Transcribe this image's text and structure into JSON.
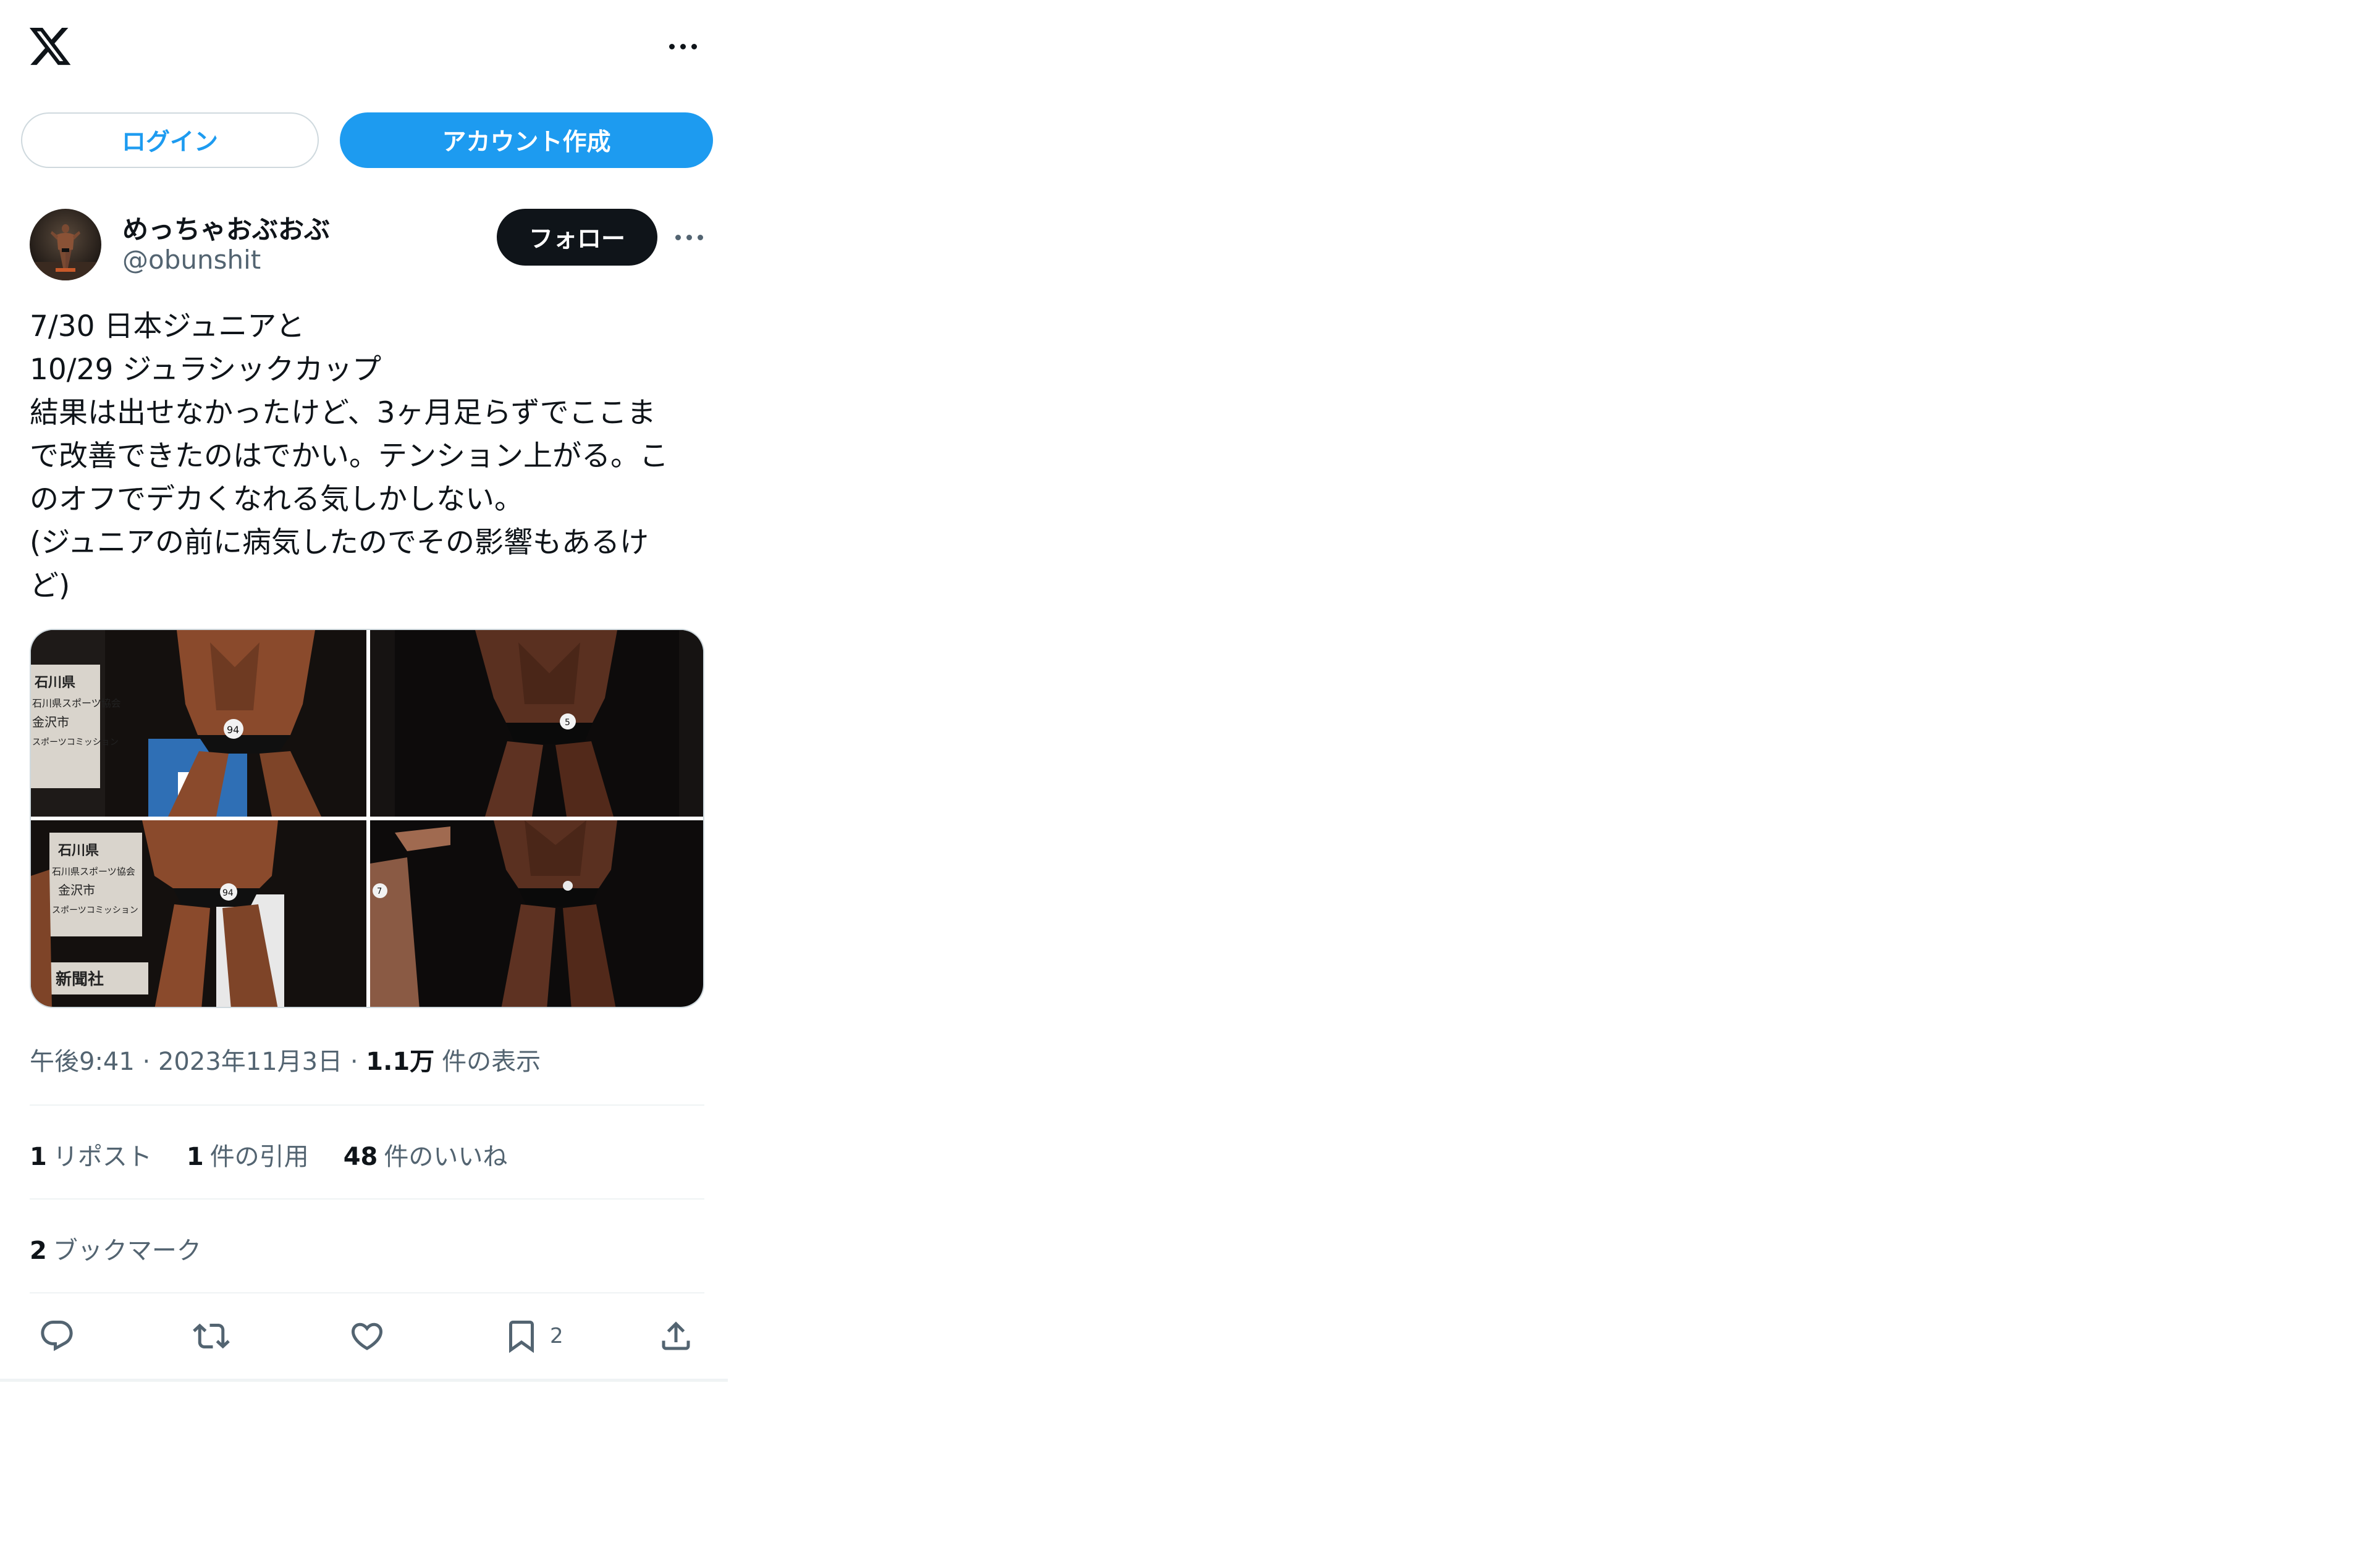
{
  "header": {
    "logo_icon": "x-logo-icon",
    "more_icon": "more-dots-icon"
  },
  "auth": {
    "login_label": "ログイン",
    "signup_label": "アカウント作成"
  },
  "author": {
    "display_name": "めっちゃおぶおぶ",
    "handle": "@obunshit",
    "follow_label": "フォロー"
  },
  "tweet": {
    "lines": [
      "7/30 日本ジュニアと",
      "10/29 ジュラシックカップ",
      "結果は出せなかったけど、3ヶ月足らずでここま",
      "で改善できたのはでかい。テンション上がる。こ",
      "のオフでデカくなれる気しかしない。",
      "(ジュニアの前に病気したのでその影響もあるけ",
      "ど)"
    ],
    "images": [
      {
        "sign": [
          "石川県",
          "石川県スポーツ協会",
          "金沢市",
          "スポーツコミッション"
        ],
        "bib": "94"
      },
      {
        "sign": [],
        "bib": "5"
      },
      {
        "sign": [
          "石川県",
          "石川県スポーツ協会",
          "金沢市",
          "スポーツコミッション",
          "新聞社"
        ],
        "bib": "94"
      },
      {
        "sign": [],
        "bib": "7"
      }
    ]
  },
  "meta": {
    "time": "午後9:41",
    "date": "2023年11月3日",
    "views_count": "1.1万",
    "views_label": "件の表示"
  },
  "stats": {
    "reposts_count": "1",
    "reposts_label": "リポスト",
    "quotes_count": "1",
    "quotes_label": "件の引用",
    "likes_count": "48",
    "likes_label": "件のいいね",
    "bookmarks_count": "2",
    "bookmarks_label": "ブックマーク"
  },
  "actions": {
    "reply_icon": "reply-icon",
    "repost_icon": "repost-icon",
    "like_icon": "like-icon",
    "bookmark_icon": "bookmark-icon",
    "bookmark_count": "2",
    "share_icon": "share-icon"
  },
  "colors": {
    "accent": "#1d9bf0",
    "text": "#0f1419",
    "secondary": "#536471",
    "border": "#cfd9de"
  }
}
